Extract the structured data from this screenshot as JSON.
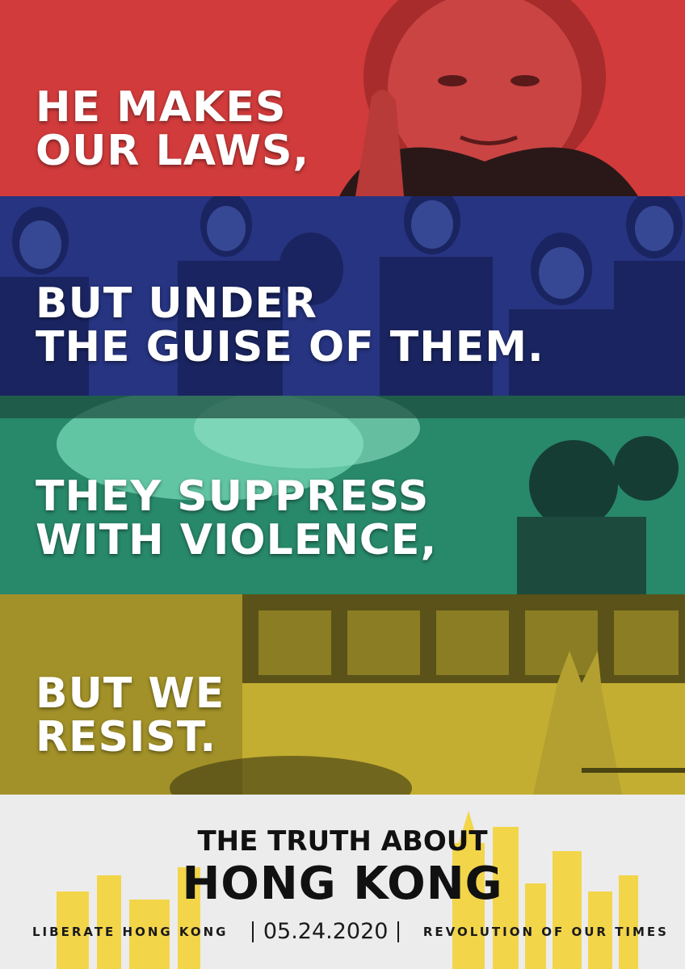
{
  "colors": {
    "red": "#d9403f",
    "blue": "#2b3a8c",
    "green": "#2f9a78",
    "yellow": "#d9c23a",
    "footer_bg": "#ececec",
    "skyline": "#f3d54a"
  },
  "bands": [
    {
      "lines": [
        "HE MAKES",
        "OUR LAWS,"
      ]
    },
    {
      "lines": [
        "BUT UNDER",
        "THE GUISE OF THEM."
      ]
    },
    {
      "lines": [
        "THEY SUPPRESS",
        "WITH VIOLENCE,"
      ]
    },
    {
      "lines": [
        "BUT WE",
        "RESIST."
      ]
    }
  ],
  "footer": {
    "title_line1": "THE TRUTH ABOUT",
    "title_line2": "HONG KONG",
    "slogan_left": "LIBERATE HONG KONG",
    "date": "05.24.2020",
    "slogan_right": "REVOLUTION OF OUR TIMES"
  }
}
